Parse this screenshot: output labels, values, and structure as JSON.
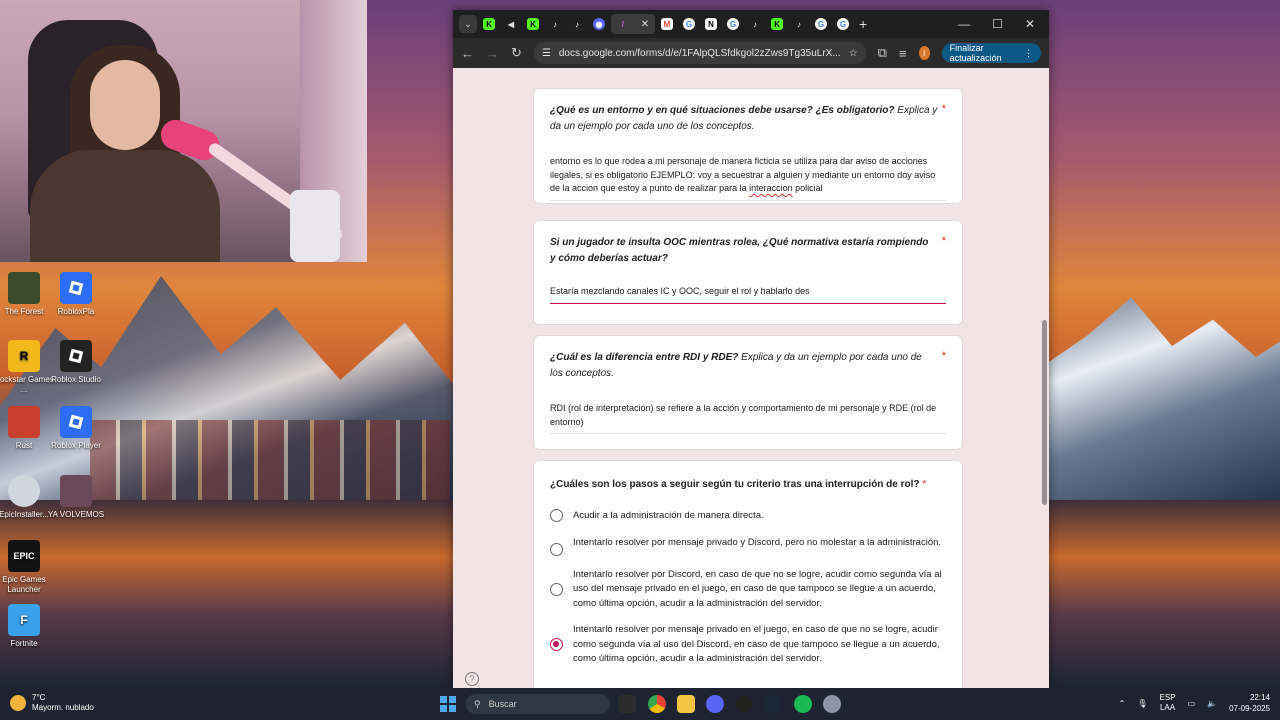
{
  "desktop": {
    "icons": [
      {
        "label": "The Forest",
        "glyph": "",
        "color": "#3a4a2a"
      },
      {
        "label": "RobloxPla",
        "glyph": "",
        "color": "#2d6df6"
      },
      {
        "label": "Rockstar Games ...",
        "glyph": "R",
        "color": "#f2b81c"
      },
      {
        "label": "Roblox Studio",
        "glyph": "",
        "color": "#222222"
      },
      {
        "label": "Rust",
        "glyph": "",
        "color": "#c8402c"
      },
      {
        "label": "Roblox Player",
        "glyph": "",
        "color": "#2d6df6"
      },
      {
        "label": "EpicInstaller...",
        "glyph": "",
        "color": "#cfd6de"
      },
      {
        "label": "YA VOLVEMOS",
        "glyph": "",
        "color": "#6a4a5a"
      },
      {
        "label": "Epic Games Launcher",
        "glyph": "EPIC",
        "color": "#111111"
      },
      {
        "label": "Fortnite",
        "glyph": "F",
        "color": "#3aa0e8"
      }
    ]
  },
  "browser": {
    "tab_dropdown": "⌄",
    "tabs": [
      {
        "icon": "kick-icon",
        "glyph": "K",
        "color": "#53fc18"
      },
      {
        "icon": "speaker-icon",
        "glyph": "◀",
        "color": "#dddddd"
      },
      {
        "icon": "kick-icon",
        "glyph": "K",
        "color": "#53fc18"
      },
      {
        "icon": "tiktok-icon",
        "glyph": "♪",
        "color": "#ffffff"
      },
      {
        "icon": "tiktok-icon",
        "glyph": "♪",
        "color": "#ffffff"
      },
      {
        "icon": "discord-icon",
        "glyph": "◉",
        "color": "#5865f2"
      },
      {
        "icon": "forms-icon",
        "glyph": "/",
        "color": "#b66bd6"
      }
    ],
    "active_close": "✕",
    "tabs_after": [
      {
        "icon": "gmail-icon",
        "glyph": "M",
        "color": "#ea4335"
      },
      {
        "icon": "google-icon",
        "glyph": "G",
        "color": "#ffffff"
      },
      {
        "icon": "notion-icon",
        "glyph": "N",
        "color": "#ffffff"
      },
      {
        "icon": "google-icon",
        "glyph": "G",
        "color": "#ffffff"
      },
      {
        "icon": "tiktok-icon",
        "glyph": "♪",
        "color": "#ffffff"
      },
      {
        "icon": "kick-icon",
        "glyph": "K",
        "color": "#53fc18"
      },
      {
        "icon": "tiktok-icon",
        "glyph": "♪",
        "color": "#ffffff"
      },
      {
        "icon": "google-icon",
        "glyph": "G",
        "color": "#ffffff"
      },
      {
        "icon": "google-icon",
        "glyph": "G",
        "color": "#ffffff"
      }
    ],
    "new_tab": "+",
    "window_controls": {
      "minimize": "—",
      "maximize": "☐",
      "close": "✕"
    },
    "url": "docs.google.com/forms/d/e/1FAlpQLSfdkgol2zZws9Tg35uLrX...",
    "profile_initial": "I",
    "update_button": "Finalizar actualización",
    "update_menu": "⋮"
  },
  "form": {
    "q1": {
      "title_bold": "¿Qué es un entorno y en qué situaciones debe usarse? ¿Es obligatorio?",
      "title_rest": " Explica y da un ejemplo por cada uno de los conceptos.",
      "required": "*",
      "answer_before": "entorno es lo que rodea a mi personaje de manera ficticia se utiliza para dar aviso de acciones ilegales, si es obligatorio EJEMPLO: voy a secuestrar a alguien y mediante un entorno doy aviso de la accion que estoy a punto de realizar para la ",
      "answer_misspelled": "interaccion",
      "answer_after": " policial"
    },
    "q2": {
      "title_bold": "Si un jugador te insulta OOC mientras rolea, ¿Qué normativa estaría rompiendo y cómo deberías actuar?",
      "required": "*",
      "answer": "Estaría mezclando canales IC y OOC, seguir el rol y hablarlo des"
    },
    "q3": {
      "title_bold": "¿Cuál es la diferencia entre RDI y RDE?",
      "title_rest": "  Explica y da un ejemplo por cada uno de los conceptos.",
      "required": "*",
      "answer": "RDI (rol de interpretación) se refiere a la acción y comportamiento de mi personaje y RDE (rol de entorno)"
    },
    "q4": {
      "title": "¿Cuáles son los pasos a seguir según tu criterio tras una interrupción de rol?",
      "required": "*",
      "options": [
        "Acudir a la administración de manera directa.",
        "Intentarlo resolver por mensaje privado y Discord, pero no molestar a la administración.",
        "Intentarlo resolver por Discord, en caso de que no se logre, acudir como segunda vía al uso del mensaje privado en el juego, en caso de que tampoco se llegue a un acuerdo, como última opción, acudir a la administración del servidor.",
        "Intentarlo resolver por mensaje privado en el juego, en caso de que no se logre, acudir como segunda vía al uso del Discord, en caso de que tampoco se llegue a un acuerdo, como última opción, acudir a la administración del servidor."
      ],
      "selected_index": 3
    },
    "help": "?"
  },
  "taskbar": {
    "temperature": "7°C",
    "weather": "Mayorm. nublado",
    "search_placeholder": "Buscar",
    "lang_1": "ESP",
    "lang_2": "LAA",
    "time": "22:14",
    "date": "07-09-2025"
  }
}
